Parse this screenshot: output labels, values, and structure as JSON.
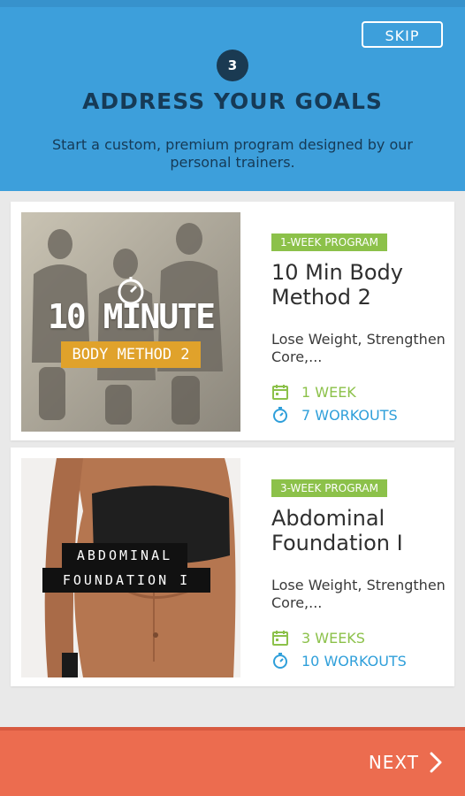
{
  "header": {
    "skip_label": "SKIP",
    "step_number": "3",
    "title": "ADDRESS YOUR GOALS",
    "subtitle": "Start a custom, premium program designed by our personal trainers."
  },
  "programs": [
    {
      "badge": "1-WEEK PROGRAM",
      "name": "10 Min Body Method 2",
      "goals": "Lose Weight, Strengthen Core,...",
      "duration": "1 WEEK",
      "workouts": "7 WORKOUTS",
      "image_title_line1": "10 MINUTE",
      "image_title_line2": "BODY METHOD 2",
      "icons": {
        "calendar": "calendar-icon",
        "timer": "stopwatch-icon"
      }
    },
    {
      "badge": "3-WEEK PROGRAM",
      "name": "Abdominal Foundation I",
      "goals": "Lose Weight, Strengthen Core,...",
      "duration": "3 WEEKS",
      "workouts": "10 WORKOUTS",
      "image_title_line1": "ABDOMINAL",
      "image_title_line2": "FOUNDATION I",
      "icons": {
        "calendar": "calendar-icon",
        "timer": "stopwatch-icon"
      }
    }
  ],
  "footer": {
    "next_label": "NEXT",
    "icon": "chevron-right-icon"
  },
  "colors": {
    "header_blue": "#3d9fdb",
    "title_navy": "#163a56",
    "badge_green": "#8cc14a",
    "link_blue": "#2f9fda",
    "footer_orange": "#ec6c4f",
    "image_accent_gold": "#e0a22b"
  }
}
